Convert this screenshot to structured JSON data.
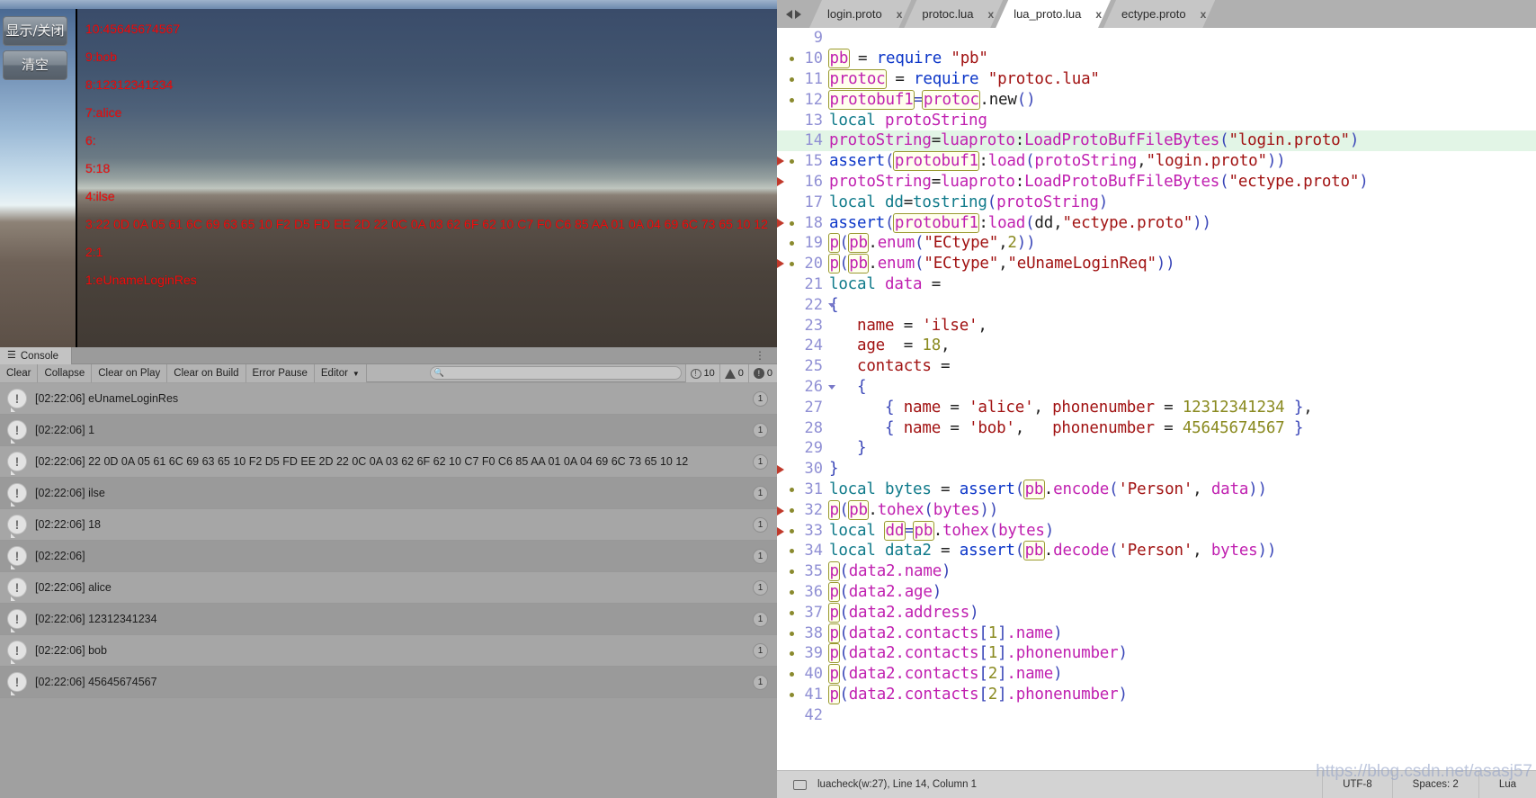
{
  "unity": {
    "buttons": [
      {
        "name": "toggle-display-button",
        "label": "显示/关闭"
      },
      {
        "name": "clear-button",
        "label": "清空"
      }
    ],
    "game_overlay_lines": [
      "10:45645674567",
      "9:bob",
      "8:12312341234",
      "7:alice",
      "6:",
      "5:18",
      "4:ilse",
      "3:22 0D 0A 05 61 6C 69 63 65 10 F2 D5 FD EE 2D 22 0C 0A 03 62 6F 62 10 C7 F0 C6 85 AA 01 0A 04 69 6C 73 65 10 12",
      "2:1",
      "1:eUnameLoginRes"
    ]
  },
  "console": {
    "tab_label": "Console",
    "toolbar": [
      {
        "name": "clear-button",
        "label": "Clear"
      },
      {
        "name": "collapse-button",
        "label": "Collapse"
      },
      {
        "name": "clear-on-play-button",
        "label": "Clear on Play"
      },
      {
        "name": "clear-on-build-button",
        "label": "Clear on Build"
      },
      {
        "name": "error-pause-button",
        "label": "Error Pause"
      },
      {
        "name": "editor-dropdown",
        "label": "Editor"
      }
    ],
    "search": {
      "value": "",
      "placeholder": ""
    },
    "counters": {
      "info": "10",
      "warning": "0",
      "error": "0"
    },
    "log_entries": [
      {
        "time": "[02:22:06]",
        "message": "eUnameLoginRes",
        "count": "1"
      },
      {
        "time": "[02:22:06]",
        "message": "1",
        "count": "1"
      },
      {
        "time": "[02:22:06]",
        "message": "22 0D 0A 05 61 6C 69 63 65 10 F2 D5 FD EE 2D 22 0C 0A 03 62 6F 62 10 C7 F0 C6 85 AA 01 0A 04 69 6C 73 65 10 12",
        "count": "1"
      },
      {
        "time": "[02:22:06]",
        "message": "ilse",
        "count": "1"
      },
      {
        "time": "[02:22:06]",
        "message": "18",
        "count": "1"
      },
      {
        "time": "[02:22:06]",
        "message": "",
        "count": "1"
      },
      {
        "time": "[02:22:06]",
        "message": "alice",
        "count": "1"
      },
      {
        "time": "[02:22:06]",
        "message": "12312341234",
        "count": "1"
      },
      {
        "time": "[02:22:06]",
        "message": "bob",
        "count": "1"
      },
      {
        "time": "[02:22:06]",
        "message": "45645674567",
        "count": "1"
      }
    ]
  },
  "editor": {
    "tabs": [
      {
        "label": "login.proto",
        "active": false,
        "close": "x"
      },
      {
        "label": "protoc.lua",
        "active": false,
        "close": "x"
      },
      {
        "label": "lua_proto.lua",
        "active": true,
        "close": "x"
      },
      {
        "label": "ectype.proto",
        "active": false,
        "close": "x"
      }
    ],
    "first_visible_line": "9",
    "code_lines": [
      {
        "num": "9",
        "text": ""
      },
      {
        "num": "10",
        "text": "pb = require \"pb\""
      },
      {
        "num": "11",
        "text": "protoc = require \"protoc.lua\""
      },
      {
        "num": "12",
        "text": "protobuf1=protoc.new()"
      },
      {
        "num": "13",
        "text": "local protoString"
      },
      {
        "num": "14",
        "text": "protoString=luaproto:LoadProtoBufFileBytes(\"login.proto\")"
      },
      {
        "num": "15",
        "text": "assert(protobuf1:load(protoString,\"login.proto\"))"
      },
      {
        "num": "16",
        "text": "protoString=luaproto:LoadProtoBufFileBytes(\"ectype.proto\")"
      },
      {
        "num": "17",
        "text": "local dd=tostring(protoString)"
      },
      {
        "num": "18",
        "text": "assert(protobuf1:load(dd,\"ectype.proto\"))"
      },
      {
        "num": "19",
        "text": "p(pb.enum(\"ECtype\",2))"
      },
      {
        "num": "20",
        "text": "p(pb.enum(\"ECtype\",\"eUnameLoginReq\"))"
      },
      {
        "num": "21",
        "text": "local data ="
      },
      {
        "num": "22",
        "text": "{"
      },
      {
        "num": "23",
        "text": "   name = 'ilse',"
      },
      {
        "num": "24",
        "text": "   age  = 18,"
      },
      {
        "num": "25",
        "text": "   contacts ="
      },
      {
        "num": "26",
        "text": "   {"
      },
      {
        "num": "27",
        "text": "      { name = 'alice', phonenumber = 12312341234 },"
      },
      {
        "num": "28",
        "text": "      { name = 'bob',   phonenumber = 45645674567 }"
      },
      {
        "num": "29",
        "text": "   }"
      },
      {
        "num": "30",
        "text": "}"
      },
      {
        "num": "31",
        "text": "local bytes = assert(pb.encode('Person', data))"
      },
      {
        "num": "32",
        "text": "p(pb.tohex(bytes))"
      },
      {
        "num": "33",
        "text": "local dd=pb.tohex(bytes)"
      },
      {
        "num": "34",
        "text": "local data2 = assert(pb.decode('Person', bytes))"
      },
      {
        "num": "35",
        "text": "p(data2.name)"
      },
      {
        "num": "36",
        "text": "p(data2.age)"
      },
      {
        "num": "37",
        "text": "p(data2.address)"
      },
      {
        "num": "38",
        "text": "p(data2.contacts[1].name)"
      },
      {
        "num": "39",
        "text": "p(data2.contacts[1].phonenumber)"
      },
      {
        "num": "40",
        "text": "p(data2.contacts[2].name)"
      },
      {
        "num": "41",
        "text": "p(data2.contacts[2].phonenumber)"
      },
      {
        "num": "42",
        "text": ""
      }
    ],
    "statusbar": {
      "left": "luacheck(w:27), Line 14, Column 1",
      "encoding": "UTF-8",
      "indent": "Spaces: 2",
      "language": "Lua"
    },
    "watermark": "https://blog.csdn.net/asasj57"
  },
  "colors": {
    "accent_red": "#f40b0b",
    "highlight_line": "#e2f5e6",
    "gutter": "#8f8fd4"
  }
}
